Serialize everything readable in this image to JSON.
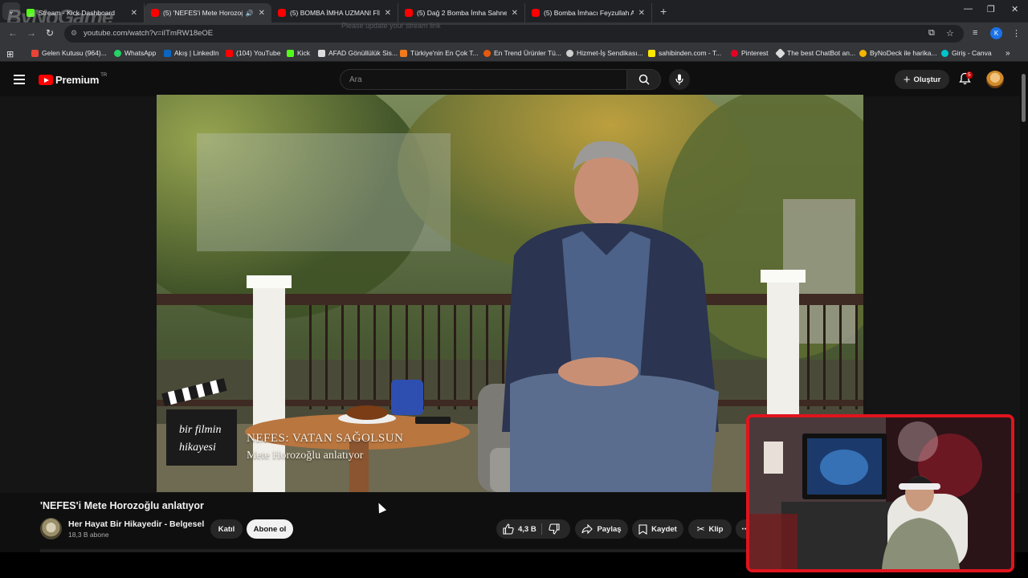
{
  "browser": {
    "tabs": [
      {
        "title": "Stream - Kick Dashboard",
        "icon": "kick-icon",
        "active": false
      },
      {
        "title": "(5) 'NEFES'i Mete Horozoğlu",
        "icon": "youtube-icon",
        "active": true
      },
      {
        "title": "(5) BOMBA İMHA UZMANI FİL",
        "icon": "youtube-icon",
        "active": false
      },
      {
        "title": "(5) Dağ 2 Bomba İmha Sahnesi",
        "icon": "youtube-icon",
        "active": false
      },
      {
        "title": "(5) Bomba İmhacı Feyzullah Alt",
        "icon": "youtube-icon",
        "active": false
      }
    ],
    "url": "youtube.com/watch?v=iITmRW18eOE",
    "banner_ghost": "Please update your stream link",
    "profile_initial": "K",
    "bookmarks": [
      "Gelen Kutusu (964)...",
      "WhatsApp",
      "Akış | LinkedIn",
      "(104) YouTube",
      "Kick",
      "AFAD Gönüllülük Sis...",
      "Türkiye'nin En Çok T...",
      "En Trend Ürünler Tü...",
      "Hizmet-İş Sendikası...",
      "sahibinden.com - T...",
      "Pinterest",
      "The best ChatBot an...",
      "ByNoDeck ile harika...",
      "Giriş - Canva"
    ]
  },
  "youtube": {
    "logo_text": "Premium",
    "logo_region": "TR",
    "search_placeholder": "Ara",
    "create_label": "Oluştur",
    "notification_count": "5",
    "video": {
      "overlay_title": "NEFES: VATAN SAĞOLSUN",
      "overlay_subtitle": "Mete Horozoğlu anlatıyor",
      "clapper_line1": "bir filmin",
      "clapper_line2": "hikayesi"
    },
    "title": "'NEFES'i Mete Horozoğlu anlatıyor",
    "channel": {
      "name": "Her Hayat Bir Hikayedir - Belgesel",
      "subscribers": "18,3 B abone",
      "join_label": "Katıl",
      "subscribe_label": "Abone ol"
    },
    "actions": {
      "likes": "4,3 B",
      "share_label": "Paylaş",
      "save_label": "Kaydet",
      "clip_label": "Klip"
    }
  },
  "overlay": {
    "watermark": "ByNoGame"
  },
  "colors": {
    "yt_red": "#ff0000",
    "webcam_border": "#e0141e",
    "page_bg": "#0f0f0f"
  }
}
